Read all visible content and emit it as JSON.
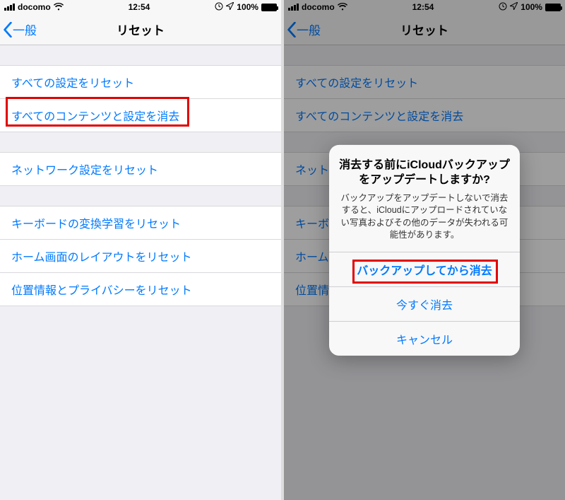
{
  "status": {
    "carrier": "docomo",
    "time": "12:54",
    "battery_pct": "100%"
  },
  "nav": {
    "back_label": "一般",
    "title": "リセット"
  },
  "groups": [
    {
      "items": [
        {
          "key": "reset_all_settings",
          "label": "すべての設定をリセット"
        },
        {
          "key": "erase_all_content",
          "label": "すべてのコンテンツと設定を消去"
        }
      ]
    },
    {
      "items": [
        {
          "key": "reset_network",
          "label": "ネットワーク設定をリセット"
        }
      ]
    },
    {
      "items": [
        {
          "key": "reset_keyboard",
          "label": "キーボードの変換学習をリセット"
        },
        {
          "key": "reset_home_layout",
          "label": "ホーム画面のレイアウトをリセット"
        },
        {
          "key": "reset_location_privacy",
          "label": "位置情報とプライバシーをリセット"
        }
      ]
    }
  ],
  "alert": {
    "title": "消去する前にiCloudバックアップをアップデートしますか?",
    "message": "バックアップをアップデートしないで消去すると、iCloudにアップロードされていない写真およびその他のデータが失われる可能性があります。",
    "buttons": {
      "backup_then_erase": "バックアップしてから消去",
      "erase_now": "今すぐ消去",
      "cancel": "キャンセル"
    }
  }
}
